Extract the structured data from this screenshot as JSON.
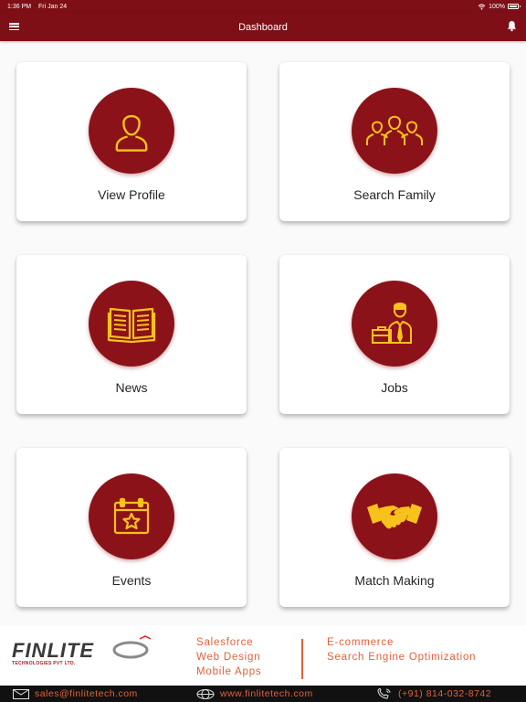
{
  "status": {
    "time": "1:36 PM",
    "date": "Fri Jan 24",
    "battery": "100%"
  },
  "header": {
    "title": "Dashboard"
  },
  "tiles": [
    {
      "label": "View Profile",
      "icon": "user-icon"
    },
    {
      "label": "Search Family",
      "icon": "family-group-icon"
    },
    {
      "label": "News",
      "icon": "open-book-icon"
    },
    {
      "label": "Jobs",
      "icon": "businessman-briefcase-icon"
    },
    {
      "label": "Events",
      "icon": "calendar-star-icon"
    },
    {
      "label": "Match Making",
      "icon": "handshake-icon"
    }
  ],
  "footer": {
    "logo_name": "FINLITE",
    "logo_sub": "TECHNOLOGIES PVT LTD.",
    "services_left": [
      "Salesforce",
      "Web Design",
      "Mobile Apps"
    ],
    "services_right": [
      "E-commerce",
      "Search Engine Optimization"
    ],
    "email": "sales@finlitetech.com",
    "website": "www.finlitetech.com",
    "phone": "(+91) 814-032-8742"
  },
  "colors": {
    "primary": "#7e0f17",
    "circle": "#8c1219",
    "icon": "#f7c21b",
    "accent": "#e2613a"
  }
}
